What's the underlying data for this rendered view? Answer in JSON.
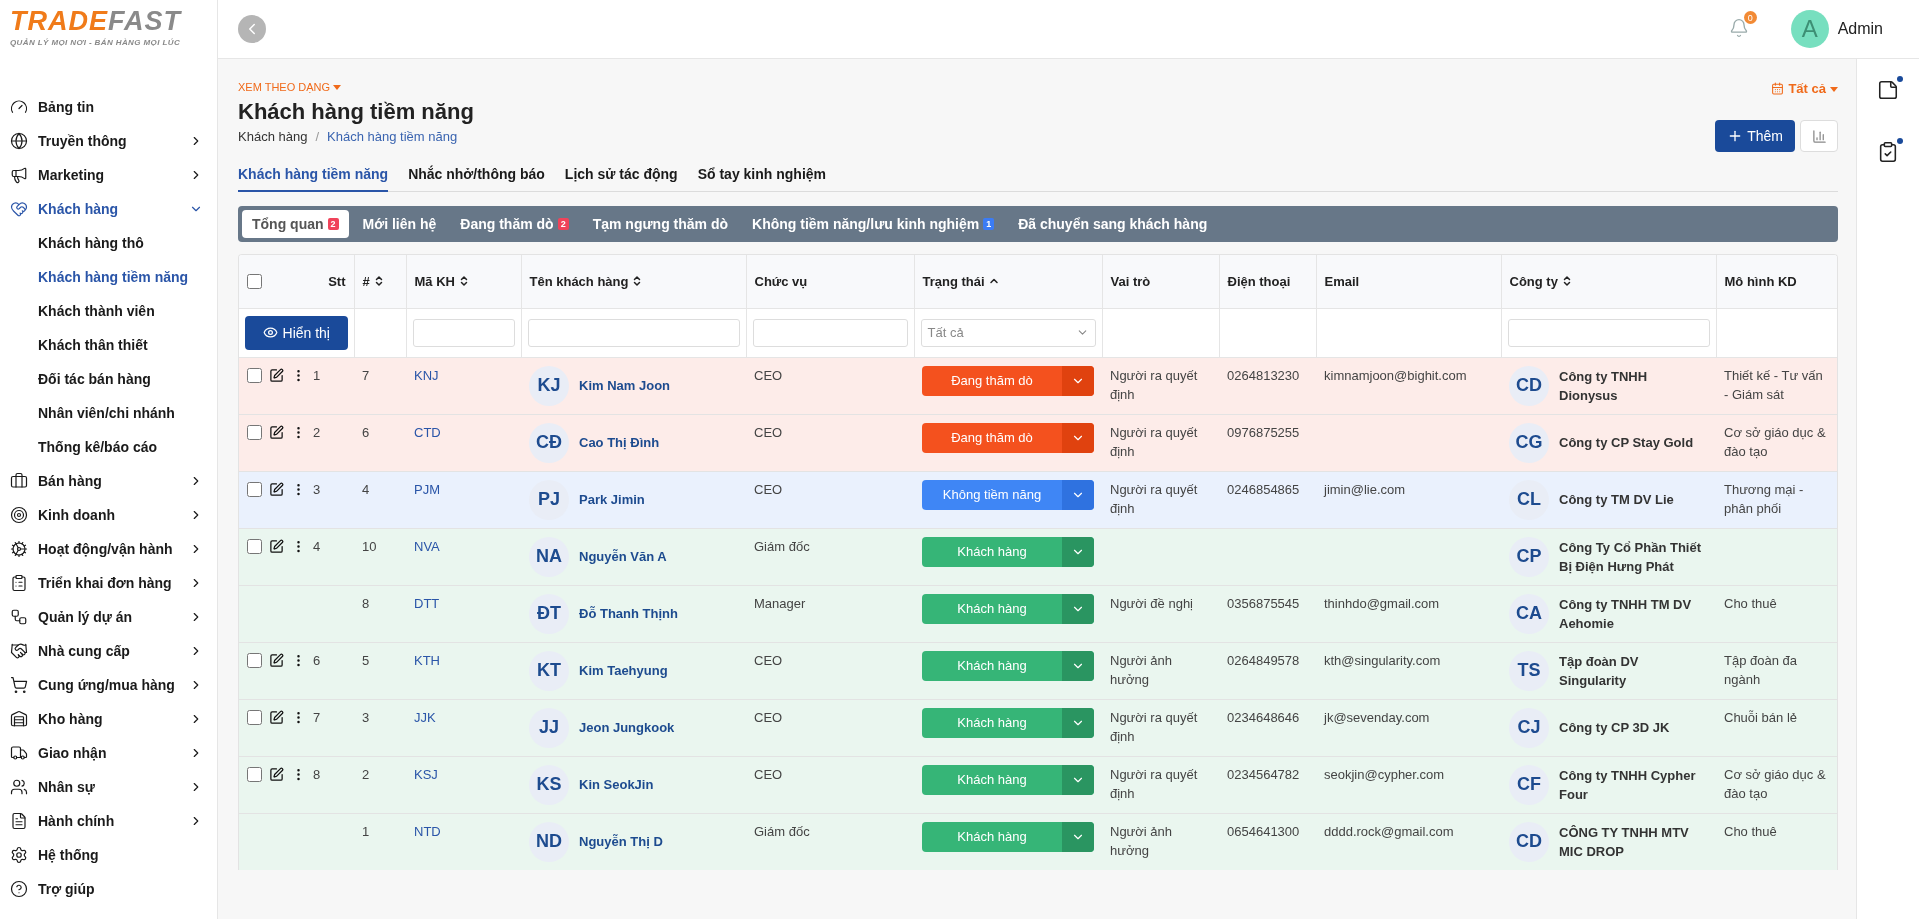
{
  "brand": {
    "name_part_1": "TRADE",
    "name_part_2": "FAST",
    "tagline": "QUẢN LÝ MỌI NƠI - BÁN HÀNG MỌI LÚC"
  },
  "sidebar": {
    "items": [
      {
        "label": "Bảng tin",
        "selected": false
      },
      {
        "label": "Truyền thông",
        "selected": false,
        "expanded": false
      },
      {
        "label": "Marketing",
        "selected": false,
        "expanded": false
      },
      {
        "label": "Khách hàng",
        "selected": true,
        "expanded": true,
        "children": [
          {
            "label": "Khách hàng thô",
            "selected": false
          },
          {
            "label": "Khách hàng tiềm năng",
            "selected": true
          },
          {
            "label": "Khách thành viên",
            "selected": false
          },
          {
            "label": "Khách thân thiết",
            "selected": false
          },
          {
            "label": "Đối tác bán hàng",
            "selected": false
          },
          {
            "label": "Nhân viên/chi nhánh",
            "selected": false
          },
          {
            "label": "Thống kê/báo cáo",
            "selected": false
          }
        ]
      },
      {
        "label": "Bán hàng",
        "selected": false,
        "expanded": false
      },
      {
        "label": "Kinh doanh",
        "selected": false,
        "expanded": false
      },
      {
        "label": "Hoạt động/vận hành",
        "selected": false,
        "expanded": false
      },
      {
        "label": "Triển khai đơn hàng",
        "selected": false,
        "expanded": false
      },
      {
        "label": "Quản lý dự án",
        "selected": false,
        "expanded": false
      },
      {
        "label": "Nhà cung cấp",
        "selected": false,
        "expanded": false
      },
      {
        "label": "Cung ứng/mua hàng",
        "selected": false,
        "expanded": false
      },
      {
        "label": "Kho hàng",
        "selected": false,
        "expanded": false
      },
      {
        "label": "Giao nhận",
        "selected": false,
        "expanded": false
      },
      {
        "label": "Nhân sự",
        "selected": false,
        "expanded": false
      },
      {
        "label": "Hành chính",
        "selected": false,
        "expanded": false
      },
      {
        "label": "Hệ thống",
        "selected": false
      },
      {
        "label": "Trợ giúp",
        "selected": false
      }
    ]
  },
  "topbar": {
    "notification_count": "0",
    "user": {
      "initial": "A",
      "name": "Admin"
    }
  },
  "right_rail": [
    {
      "has_dot": true
    },
    {
      "has_dot": true
    }
  ],
  "page": {
    "view_switch": {
      "label": "XEM THEO DẠNG",
      "expanded": false
    },
    "title": "Khách hàng tiềm năng",
    "breadcrumb_separator": "/",
    "breadcrumb": [
      {
        "label": "Khách hàng",
        "selected": false
      },
      {
        "label": "Khách hàng tiềm năng",
        "selected": true
      }
    ],
    "date_filter": "Tất cả",
    "add_button": "Thêm",
    "tabs": [
      {
        "label": "Khách hàng tiềm năng",
        "selected": true
      },
      {
        "label": "Nhắc nhở/thông báo",
        "selected": false
      },
      {
        "label": "Lịch sử tác động",
        "selected": false
      },
      {
        "label": "Sổ tay kinh nghiệm",
        "selected": false
      }
    ],
    "status_tabs": [
      {
        "label": "Tổng quan",
        "count": "2",
        "color": "#f0435a",
        "selected": true
      },
      {
        "label": "Mới liên hệ",
        "selected": false
      },
      {
        "label": "Đang thăm dò",
        "count": "2",
        "color": "#f0435a",
        "selected": false
      },
      {
        "label": "Tạm ngưng thăm dò",
        "selected": false
      },
      {
        "label": "Không tiềm năng/lưu kinh nghiệm",
        "count": "1",
        "color": "#3b7cf5",
        "selected": false
      },
      {
        "label": "Đã chuyển sang khách hàng",
        "selected": false
      }
    ]
  },
  "table": {
    "select_all_checked": false,
    "show_button": "Hiển thị",
    "columns": [
      {
        "label": "Stt",
        "kind": "button_filter",
        "sortable": false
      },
      {
        "label": "#",
        "kind": "plain",
        "sortable": true,
        "sorted": false
      },
      {
        "label": "Mã KH",
        "kind": "text_filter",
        "sortable": true,
        "sorted": false
      },
      {
        "label": "Tên khách hàng",
        "kind": "text_filter",
        "sortable": true,
        "sorted": false
      },
      {
        "label": "Chức vụ",
        "kind": "text_filter",
        "sortable": false
      },
      {
        "label": "Trạng thái",
        "kind": "select_filter",
        "sortable": true,
        "sorted": true,
        "filter_value": "Tất cả"
      },
      {
        "label": "Vai trò",
        "kind": "plain",
        "sortable": false
      },
      {
        "label": "Điện thoại",
        "kind": "plain",
        "sortable": false
      },
      {
        "label": "Email",
        "kind": "plain",
        "sortable": false
      },
      {
        "label": "Công ty",
        "kind": "text_filter",
        "sortable": true,
        "sorted": false
      },
      {
        "label": "Mô hình KD",
        "kind": "plain",
        "sortable": false
      }
    ],
    "rows": [
      {
        "stt": "1",
        "checked": false,
        "no": "7",
        "code": "KNJ",
        "initials": "KJ",
        "name": "Kim Nam Joon",
        "position": "CEO",
        "status": {
          "kind": "exploring",
          "label": "Đang thăm dò"
        },
        "role": "Người ra quyết định",
        "phone": "0264813230",
        "email": "kimnamjoon@bighit.com",
        "company_initials": "CD",
        "company": "Công ty TNHH Dionysus",
        "model": "Thiết kế - Tư vấn - Giám sát"
      },
      {
        "stt": "2",
        "checked": false,
        "no": "6",
        "code": "CTD",
        "initials": "CĐ",
        "name": "Cao Thị Đình",
        "position": "CEO",
        "status": {
          "kind": "exploring",
          "label": "Đang thăm dò"
        },
        "role": "Người ra quyết định",
        "phone": "0976875255",
        "company_initials": "CG",
        "company": "Công ty CP Stay Gold",
        "model": "Cơ sở giáo dục & đào tạo"
      },
      {
        "stt": "3",
        "checked": false,
        "no": "4",
        "code": "PJM",
        "initials": "PJ",
        "name": "Park Jimin",
        "position": "CEO",
        "status": {
          "kind": "not_potential",
          "label": "Không tiềm năng"
        },
        "role": "Người ra quyết định",
        "phone": "0246854865",
        "email": "jimin@lie.com",
        "company_initials": "CL",
        "company": "Công ty TM DV Lie",
        "model": "Thương mại - phân phối"
      },
      {
        "stt": "4",
        "checked": false,
        "no": "10",
        "code": "NVA",
        "initials": "NA",
        "name": "Nguyễn Văn A",
        "position": "Giám đốc",
        "status": {
          "kind": "customer",
          "label": "Khách hàng"
        },
        "company_initials": "CP",
        "company": "Công Ty Cổ Phần Thiết Bị Điện Hưng Phát"
      },
      {
        "no": "8",
        "code": "DTT",
        "initials": "ĐT",
        "name": "Đỗ Thanh Thịnh",
        "position": "Manager",
        "status": {
          "kind": "customer",
          "label": "Khách hàng"
        },
        "role": "Người đề nghị",
        "phone": "0356875545",
        "email": "thinhdo@gmail.com",
        "company_initials": "CA",
        "company": "Công ty TNHH TM DV Aehomie",
        "model": "Cho thuê"
      },
      {
        "stt": "6",
        "checked": false,
        "no": "5",
        "code": "KTH",
        "initials": "KT",
        "name": "Kim Taehyung",
        "position": "CEO",
        "status": {
          "kind": "customer",
          "label": "Khách hàng"
        },
        "role": "Người ảnh hưởng",
        "phone": "0264849578",
        "email": "kth@singularity.com",
        "company_initials": "TS",
        "company": "Tập đoàn DV Singularity",
        "model": "Tập đoàn đa ngành"
      },
      {
        "stt": "7",
        "checked": false,
        "no": "3",
        "code": "JJK",
        "initials": "JJ",
        "name": "Jeon Jungkook",
        "position": "CEO",
        "status": {
          "kind": "customer",
          "label": "Khách hàng"
        },
        "role": "Người ra quyết định",
        "phone": "0234648646",
        "email": "jk@sevenday.com",
        "company_initials": "CJ",
        "company": "Công ty CP 3D JK",
        "model": "Chuỗi bán lẻ"
      },
      {
        "stt": "8",
        "checked": false,
        "no": "2",
        "code": "KSJ",
        "initials": "KS",
        "name": "Kin SeokJin",
        "position": "CEO",
        "status": {
          "kind": "customer",
          "label": "Khách hàng"
        },
        "role": "Người ra quyết định",
        "phone": "0234564782",
        "email": "seokjin@cypher.com",
        "company_initials": "CF",
        "company": "Công ty TNHH Cypher Four",
        "model": "Cơ sở giáo dục & đào tạo"
      },
      {
        "no": "1",
        "code": "NTD",
        "initials": "ND",
        "name": "Nguyễn Thị D",
        "position": "Giám đốc",
        "status": {
          "kind": "customer",
          "label": "Khách hàng"
        },
        "role": "Người ảnh hưởng",
        "phone": "0654641300",
        "email": "dddd.rock@gmail.com",
        "company_initials": "CD",
        "company": "CÔNG TY TNHH MTV MIC DROP",
        "model": "Cho thuê"
      }
    ]
  }
}
